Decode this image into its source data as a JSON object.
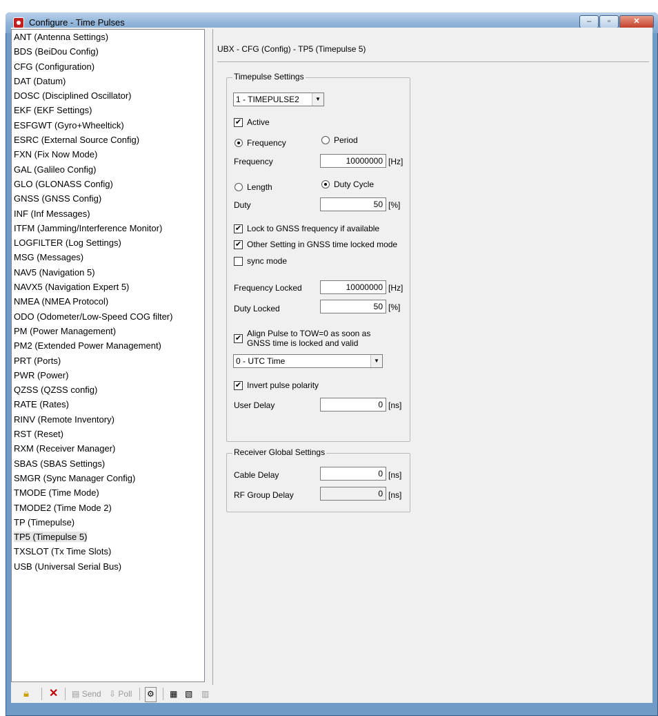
{
  "window": {
    "title": "Configure - Time Pulses",
    "min": "–",
    "max": "▫",
    "close": "✕"
  },
  "nav": {
    "items": [
      "ANT (Antenna Settings)",
      "BDS (BeiDou Config)",
      "CFG (Configuration)",
      "DAT (Datum)",
      "DOSC (Disciplined Oscillator)",
      "EKF (EKF Settings)",
      "ESFGWT (Gyro+Wheeltick)",
      "ESRC (External Source Config)",
      "FXN (Fix Now Mode)",
      "GAL (Galileo Config)",
      "GLO (GLONASS Config)",
      "GNSS (GNSS Config)",
      "INF (Inf Messages)",
      "ITFM (Jamming/Interference Monitor)",
      "LOGFILTER (Log Settings)",
      "MSG (Messages)",
      "NAV5 (Navigation 5)",
      "NAVX5 (Navigation Expert 5)",
      "NMEA (NMEA Protocol)",
      "ODO (Odometer/Low-Speed COG filter)",
      "PM (Power Management)",
      "PM2 (Extended Power Management)",
      "PRT (Ports)",
      "PWR (Power)",
      "QZSS (QZSS config)",
      "RATE (Rates)",
      "RINV (Remote Inventory)",
      "RST (Reset)",
      "RXM (Receiver Manager)",
      "SBAS (SBAS Settings)",
      "SMGR (Sync Manager Config)",
      "TMODE (Time Mode)",
      "TMODE2 (Time Mode 2)",
      "TP (Timepulse)",
      "TP5 (Timepulse 5)",
      "TXSLOT (Tx Time Slots)",
      "USB (Universal Serial Bus)"
    ],
    "selected": "TP5 (Timepulse 5)"
  },
  "header": {
    "title": "UBX - CFG (Config) - TP5 (Timepulse 5)"
  },
  "timepulse": {
    "group_label": "Timepulse Settings",
    "selector": "1 - TIMEPULSE2",
    "active_label": "Active",
    "active": true,
    "frequency_radio": "Frequency",
    "period_radio": "Period",
    "frequency_label": "Frequency",
    "frequency_value": "10000000",
    "frequency_unit": "[Hz]",
    "length_radio": "Length",
    "duty_cycle_radio": "Duty Cycle",
    "duty_label": "Duty",
    "duty_value": "50",
    "duty_unit": "[%]",
    "lock_gnss_label": "Lock to GNSS frequency if available",
    "lock_gnss": true,
    "other_setting_label": "Other Setting in GNSS time locked mode",
    "other_setting": true,
    "sync_mode_label": "sync mode",
    "sync_mode": false,
    "freq_locked_label": "Frequency Locked",
    "freq_locked_value": "10000000",
    "freq_locked_unit": "[Hz]",
    "duty_locked_label": "Duty Locked",
    "duty_locked_value": "50",
    "duty_locked_unit": "[%]",
    "align_label_1": "Align Pulse to TOW=0 as soon as",
    "align_label_2": "GNSS time is locked and valid",
    "align": true,
    "time_source": "0 - UTC Time",
    "invert_label": "Invert pulse polarity",
    "invert": true,
    "user_delay_label": "User Delay",
    "user_delay_value": "0",
    "user_delay_unit": "[ns]"
  },
  "receiver": {
    "group_label": "Receiver Global Settings",
    "cable_delay_label": "Cable Delay",
    "cable_delay_value": "0",
    "cable_delay_unit": "[ns]",
    "rf_delay_label": "RF Group Delay",
    "rf_delay_value": "0",
    "rf_delay_unit": "[ns]"
  },
  "toolbar": {
    "send": "Send",
    "poll": "Poll"
  }
}
